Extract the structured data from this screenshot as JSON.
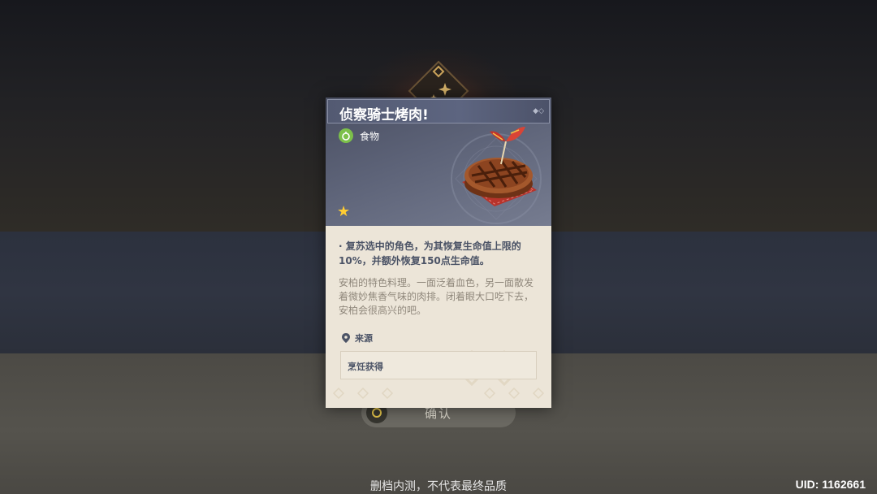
{
  "item": {
    "title": "侦察骑士烤肉!",
    "type_label": "食物",
    "type_icon": "food-icon",
    "rarity_stars": 1,
    "star_glyph": "★",
    "effect": "· 复苏选中的角色，为其恢复生命值上限的10%，并额外恢复150点生命值。",
    "description": "安柏的特色料理。一面泛着血色，另一面散发着微妙焦香气味的肉排。闭着眼大口吃下去，安柏会很高兴的吧。",
    "source_heading": "来源",
    "source_entry": "烹饪获得"
  },
  "confirm_button": {
    "label": "确认"
  },
  "footer": {
    "beta_notice": "删档内测，不代表最终品质",
    "uid": "UID: 1162661"
  },
  "colors": {
    "card_bg": "#ece5d8",
    "header_bg": "#5d6378",
    "star": "#ffcc32",
    "food_badge": "#7cc04a",
    "text_dark": "#4b5366",
    "text_muted": "#8f877b"
  }
}
